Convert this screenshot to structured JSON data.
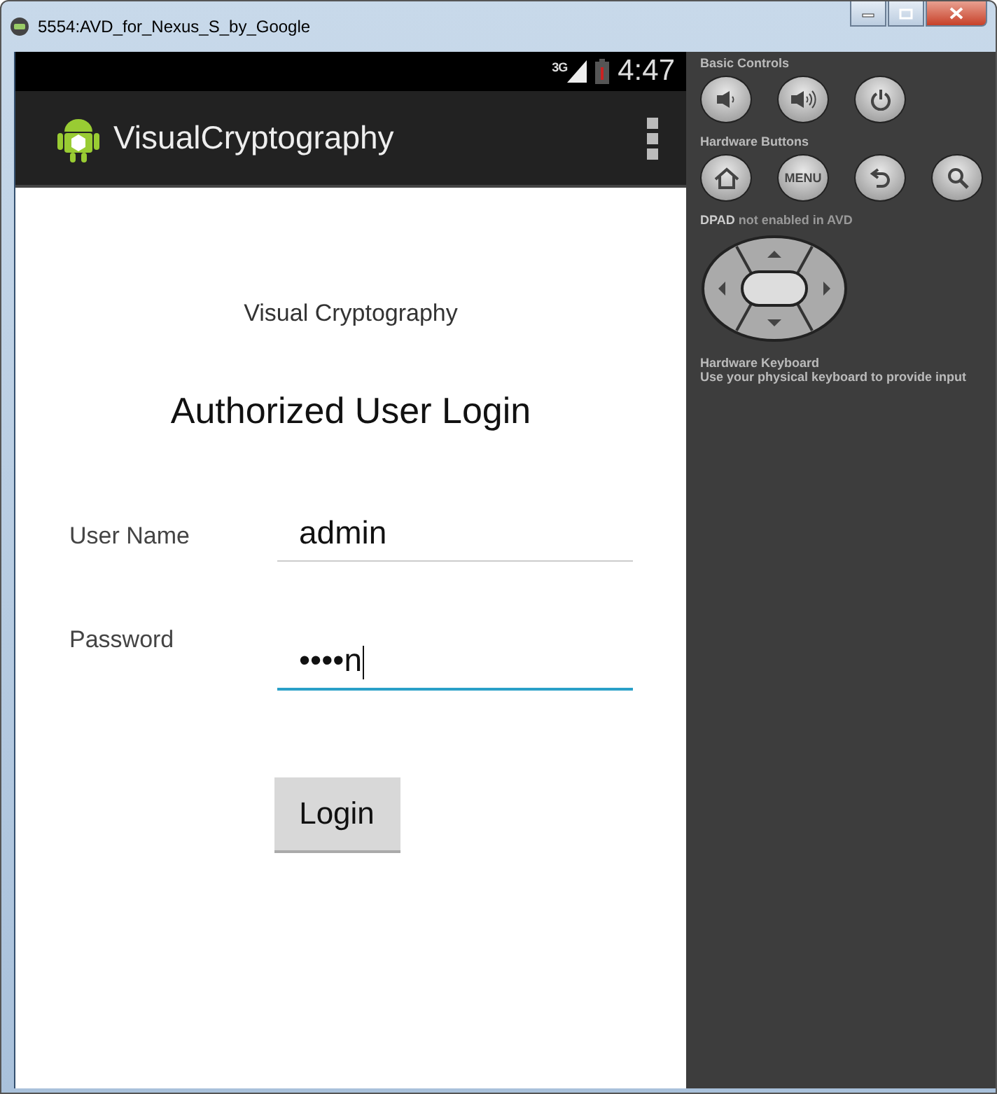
{
  "window": {
    "title": "5554:AVD_for_Nexus_S_by_Google"
  },
  "status_bar": {
    "network": "3G",
    "time": "4:47"
  },
  "action_bar": {
    "title": "VisualCryptography"
  },
  "screen": {
    "heading": "Visual Cryptography",
    "title": "Authorized User Login",
    "fields": [
      {
        "label": "User Name",
        "value": "admin",
        "focused": false
      },
      {
        "label": "Password",
        "value": "••••n",
        "focused": true
      }
    ],
    "button": "Login"
  },
  "controls": {
    "basic_title": "Basic Controls",
    "hardware_title": "Hardware Buttons",
    "menu_key": "MENU",
    "dpad_note": "**DPAD** not enabled in AVD",
    "keyboard_title": "Hardware Keyboard",
    "keyboard_note": "Use your physical keyboard to provide input"
  }
}
